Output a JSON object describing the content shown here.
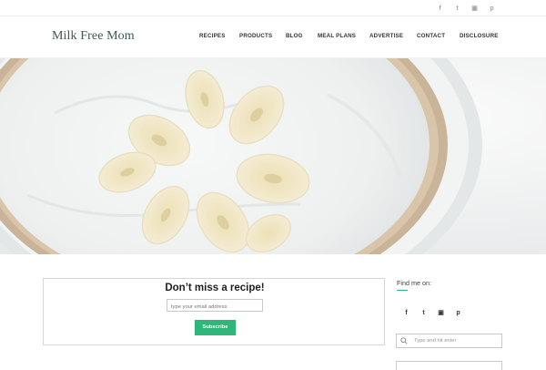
{
  "topbar": {
    "social": [
      {
        "icon": "facebook-icon",
        "glyph": "f"
      },
      {
        "icon": "twitter-icon",
        "glyph": "t"
      },
      {
        "icon": "instagram-icon",
        "glyph": "▣"
      },
      {
        "icon": "pinterest-icon",
        "glyph": "p"
      }
    ]
  },
  "header": {
    "logo": "Milk Free Mom",
    "nav": [
      "RECIPES",
      "PRODUCTS",
      "BLOG",
      "MEAL PLANS",
      "ADVERTISE",
      "CONTACT",
      "DISCLOSURE"
    ]
  },
  "subscribe": {
    "title": "Don’t miss a recipe!",
    "email_placeholder": "type your email address",
    "button_label": "Subscribe"
  },
  "sidebar": {
    "find_me_label": "Find me on:",
    "social": [
      {
        "icon": "facebook-icon",
        "glyph": "f"
      },
      {
        "icon": "twitter-icon",
        "glyph": "t"
      },
      {
        "icon": "instagram-icon",
        "glyph": "▣"
      },
      {
        "icon": "pinterest-icon",
        "glyph": "p"
      }
    ],
    "search_placeholder": "Type and hit enter"
  },
  "colors": {
    "accent": "#2fb67a",
    "logo": "#3f5653"
  }
}
